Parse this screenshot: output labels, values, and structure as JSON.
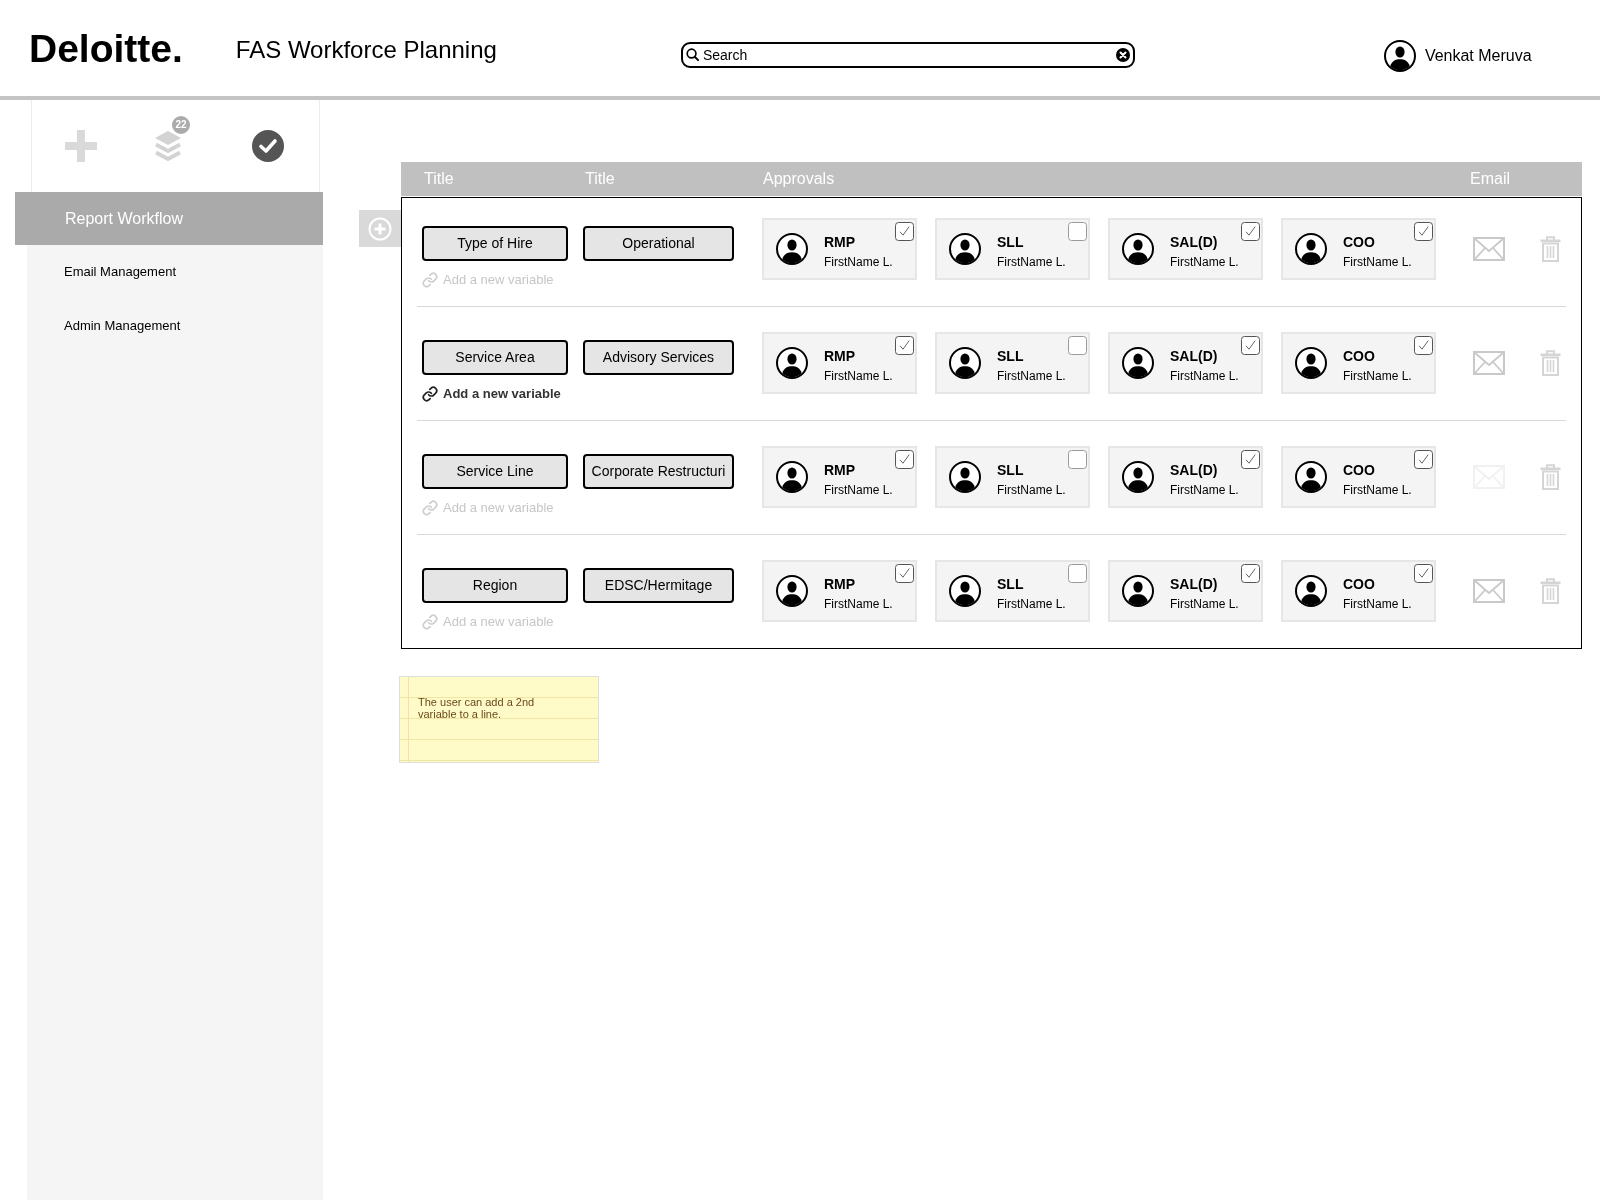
{
  "header": {
    "logo": "Deloitte.",
    "title": "FAS Workforce Planning",
    "search": {
      "placeholder": "Search"
    },
    "user": {
      "name": "Venkat Meruva"
    }
  },
  "sidebar": {
    "toolbar": {
      "layers_badge": "22"
    },
    "items": [
      {
        "label": "Report Workflow",
        "selected": true
      },
      {
        "label": "Email Management",
        "selected": false
      },
      {
        "label": "Admin Management",
        "selected": false
      }
    ]
  },
  "table": {
    "columns": [
      "Title",
      "Title",
      "Approvals",
      "Email"
    ],
    "rows": [
      {
        "variable": "Type of Hire",
        "value": "Operational",
        "add_variable": {
          "label": "Add a new variable",
          "disabled": true
        },
        "approvals": [
          {
            "role": "RMP",
            "name": "FirstName L.",
            "checked": true
          },
          {
            "role": "SLL",
            "name": "FirstName L.",
            "checked": false
          },
          {
            "role": "SAL(D)",
            "name": "FirstName L.",
            "checked": true
          },
          {
            "role": "COO",
            "name": "FirstName L.",
            "checked": true
          }
        ],
        "email_disabled": false
      },
      {
        "variable": "Service Area",
        "value": "Advisory Services",
        "add_variable": {
          "label": "Add a new variable",
          "disabled": false
        },
        "approvals": [
          {
            "role": "RMP",
            "name": "FirstName L.",
            "checked": true
          },
          {
            "role": "SLL",
            "name": "FirstName L.",
            "checked": false
          },
          {
            "role": "SAL(D)",
            "name": "FirstName L.",
            "checked": true
          },
          {
            "role": "COO",
            "name": "FirstName L.",
            "checked": true
          }
        ],
        "email_disabled": false
      },
      {
        "variable": "Service Line",
        "value": "Corporate Restructuri",
        "add_variable": {
          "label": "Add a new variable",
          "disabled": true
        },
        "approvals": [
          {
            "role": "RMP",
            "name": "FirstName L.",
            "checked": true
          },
          {
            "role": "SLL",
            "name": "FirstName L.",
            "checked": false
          },
          {
            "role": "SAL(D)",
            "name": "FirstName L.",
            "checked": true
          },
          {
            "role": "COO",
            "name": "FirstName L.",
            "checked": true
          }
        ],
        "email_disabled": true
      },
      {
        "variable": "Region",
        "value": "EDSC/Hermitage",
        "add_variable": {
          "label": "Add a new variable",
          "disabled": true
        },
        "approvals": [
          {
            "role": "RMP",
            "name": "FirstName L.",
            "checked": true
          },
          {
            "role": "SLL",
            "name": "FirstName L.",
            "checked": false
          },
          {
            "role": "SAL(D)",
            "name": "FirstName L.",
            "checked": true
          },
          {
            "role": "COO",
            "name": "FirstName L.",
            "checked": true
          }
        ],
        "email_disabled": false
      }
    ]
  },
  "note": {
    "text": "The user can add a 2nd variable to a line."
  }
}
